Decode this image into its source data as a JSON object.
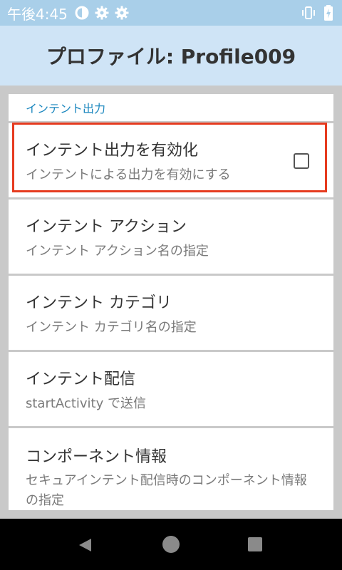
{
  "status_bar": {
    "time": "午後4:45",
    "left_icons": [
      "data-saver-icon",
      "gear-icon",
      "gear-icon"
    ],
    "right_icons": [
      "vibrate-icon",
      "battery-charging-icon"
    ]
  },
  "app_bar": {
    "title": "プロファイル: Profile009"
  },
  "section": {
    "title": "インテント出力"
  },
  "items": [
    {
      "title": "インテント出力を有効化",
      "summary": "インテントによる出力を有効にする",
      "checked": false
    },
    {
      "title": "インテント アクション",
      "summary": "インテント アクション名の指定"
    },
    {
      "title": "インテント カテゴリ",
      "summary": "インテント カテゴリ名の指定"
    },
    {
      "title": "インテント配信",
      "summary": "startActivity で送信"
    },
    {
      "title": "コンポーネント情報",
      "summary": "セキュアインテント配信時のコンポーネント情報の指定"
    }
  ],
  "nav": {
    "icons": [
      "back-icon",
      "home-icon",
      "recents-icon"
    ]
  },
  "colors": {
    "accent": "#1d88bf",
    "highlight": "#e63b1f",
    "app_bar": "#cfe4f6",
    "status_bar": "#a9cfe9"
  }
}
